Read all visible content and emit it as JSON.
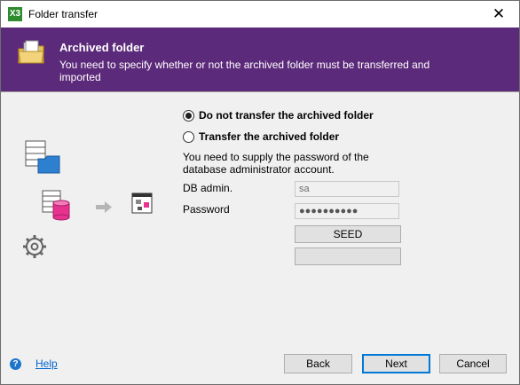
{
  "window": {
    "title": "Folder transfer",
    "close_glyph": "✕",
    "app_icon_text": "X3"
  },
  "banner": {
    "title": "Archived folder",
    "description": "You need to specify whether or not the archived folder must be transferred and imported"
  },
  "options": {
    "do_not_transfer": "Do not transfer the archived folder",
    "transfer": "Transfer the archived folder",
    "selected": "do_not_transfer"
  },
  "note": "You need to supply the password of the database administrator account.",
  "fields": {
    "db_admin_label": "DB admin.",
    "db_admin_value": "sa",
    "password_label": "Password",
    "password_value": "●●●●●●●●●●"
  },
  "buttons": {
    "seed": "SEED",
    "extra": "",
    "back": "Back",
    "next": "Next",
    "cancel": "Cancel"
  },
  "help": {
    "icon": "?",
    "label": "Help"
  },
  "icons": [
    "app-x3-icon",
    "archive-folder-icon",
    "server-folder-icon",
    "database-server-icon",
    "arrow-right-icon",
    "diagram-window-icon",
    "gear-icon",
    "help-icon"
  ]
}
